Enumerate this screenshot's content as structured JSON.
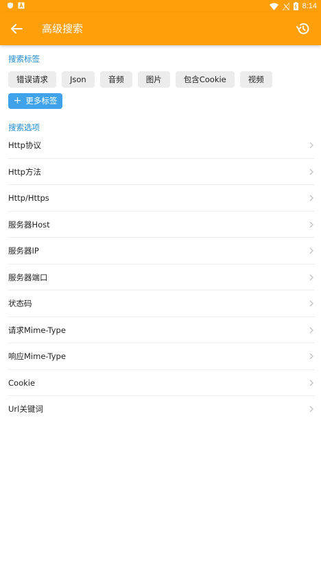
{
  "status_bar": {
    "time": "8:14"
  },
  "appbar": {
    "title": "高级搜索"
  },
  "tags_section": {
    "title": "搜索标签",
    "tags": [
      "错误请求",
      "Json",
      "音频",
      "图片",
      "包含Cookie",
      "视频"
    ],
    "more_label": "更多标签"
  },
  "options_section": {
    "title": "搜索选项",
    "items": [
      "Http协议",
      "Http方法",
      "Http/Https",
      "服务器Host",
      "服务器IP",
      "服务器端口",
      "状态码",
      "请求Mime-Type",
      "响应Mime-Type",
      "Cookie",
      "Url关键词"
    ]
  },
  "colors": {
    "accent": "#ff9f0a",
    "link": "#1e88d8",
    "button": "#3fa2ea"
  }
}
